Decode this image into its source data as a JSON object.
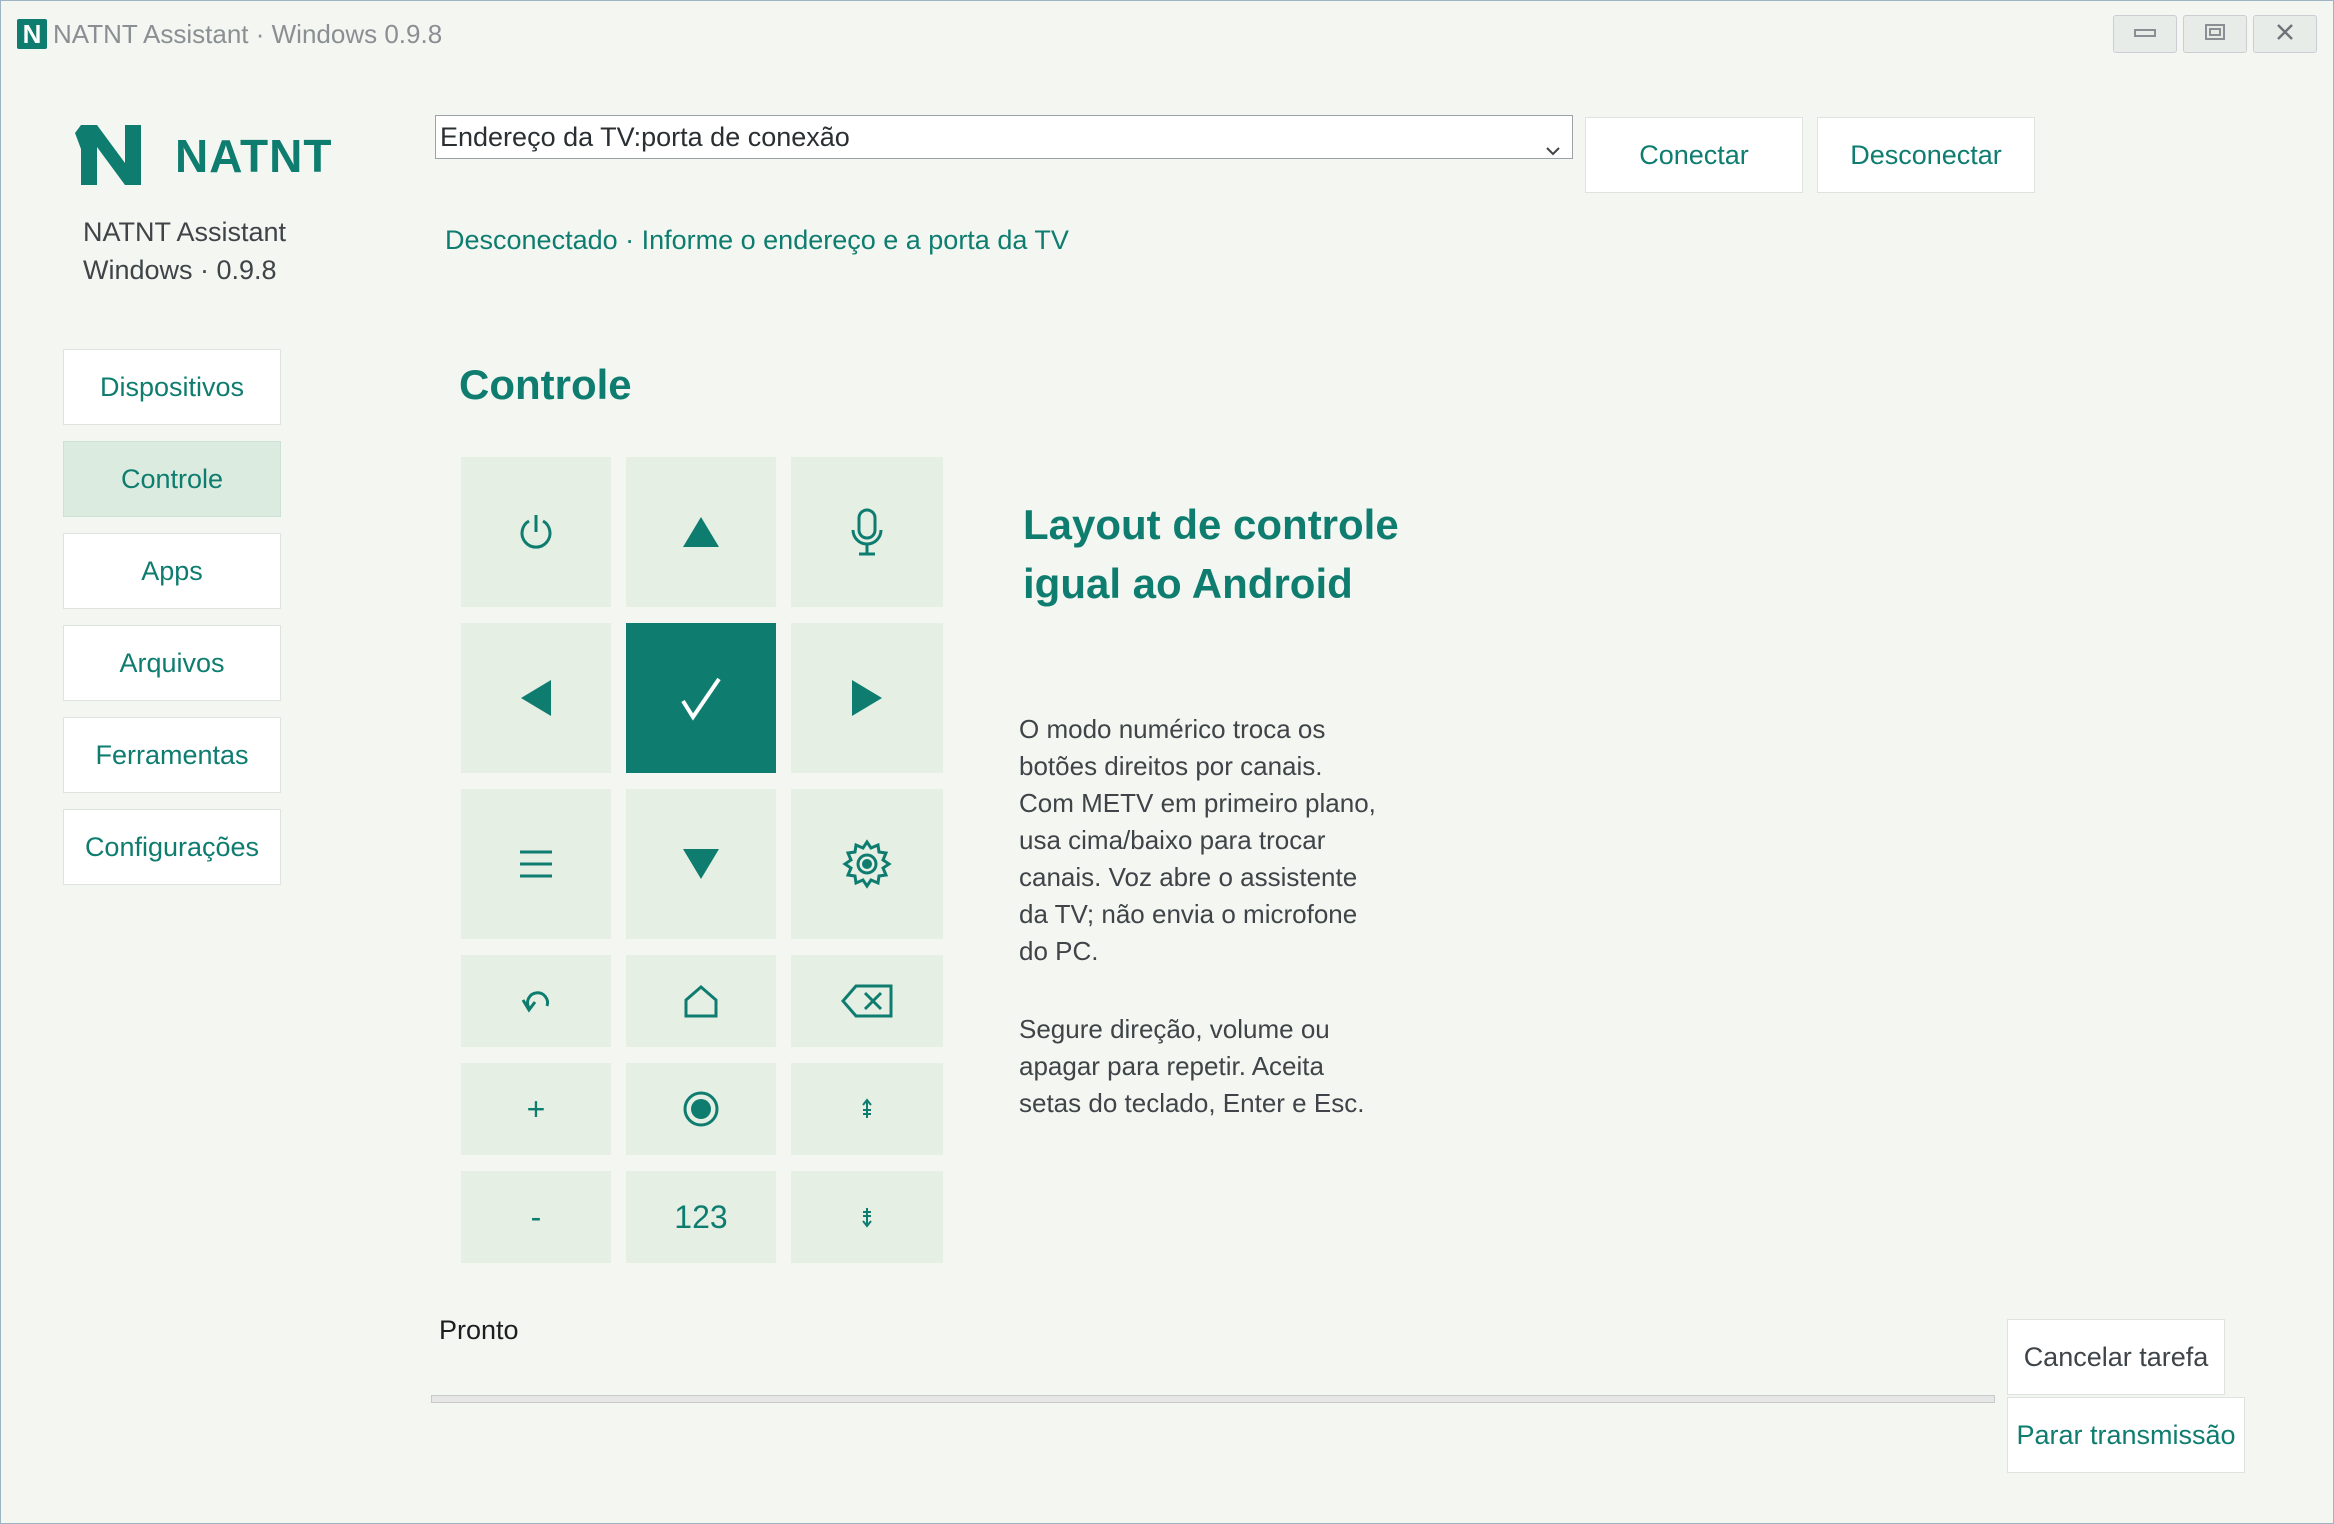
{
  "window": {
    "title": "NATNT Assistant · Windows 0.9.8",
    "app_icon_letter": "N",
    "controls": [
      "minimize-icon",
      "maximize-icon",
      "close-icon"
    ]
  },
  "brand": {
    "logo_text": "NATNT",
    "app_name": "NATNT Assistant",
    "platform_version": "Windows · 0.9.8",
    "accent_color": "#0e7d6f"
  },
  "sidebar": {
    "items": [
      {
        "label": "Dispositivos",
        "active": false
      },
      {
        "label": "Controle",
        "active": true
      },
      {
        "label": "Apps",
        "active": false
      },
      {
        "label": "Arquivos",
        "active": false
      },
      {
        "label": "Ferramentas",
        "active": false
      },
      {
        "label": "Configurações",
        "active": false
      }
    ]
  },
  "connection": {
    "address_value": "Endereço da TV:porta de conexão",
    "connect_label": "Conectar",
    "disconnect_label": "Desconectar",
    "status": "Desconectado · Informe o endereço e a porta da TV"
  },
  "main": {
    "section_title": "Controle",
    "remote_buttons": [
      {
        "name": "power-button",
        "icon": "power-icon"
      },
      {
        "name": "up-button",
        "icon": "triangle-up-icon"
      },
      {
        "name": "voice-button",
        "icon": "microphone-icon"
      },
      {
        "name": "left-button",
        "icon": "triangle-left-icon"
      },
      {
        "name": "ok-button",
        "icon": "checkmark-icon"
      },
      {
        "name": "right-button",
        "icon": "triangle-right-icon"
      },
      {
        "name": "menu-button",
        "icon": "hamburger-icon"
      },
      {
        "name": "down-button",
        "icon": "triangle-down-icon"
      },
      {
        "name": "settings-button",
        "icon": "gear-icon"
      },
      {
        "name": "back-button",
        "icon": "undo-arrow-icon"
      },
      {
        "name": "home-button",
        "icon": "home-icon"
      },
      {
        "name": "delete-button",
        "icon": "backspace-icon"
      },
      {
        "name": "volume-up-button",
        "text": "+"
      },
      {
        "name": "record-button",
        "icon": "record-icon"
      },
      {
        "name": "channel-up-button",
        "icon": "small-arrow-up-icon"
      },
      {
        "name": "volume-down-button",
        "text": "-"
      },
      {
        "name": "numeric-button",
        "text": "123"
      },
      {
        "name": "channel-down-button",
        "icon": "small-arrow-down-icon"
      }
    ],
    "info_title": "Layout de controle igual ao Android",
    "info_paragraph_1": "O modo numérico troca os botões direitos por canais. Com METV em primeiro plano, usa cima/baixo para trocar canais. Voz abre o assistente da TV; não envia o microfone do PC.",
    "info_paragraph_2": "Segure direção, volume ou apagar para repetir. Aceita setas do teclado, Enter e Esc."
  },
  "footer": {
    "status": "Pronto",
    "progress_fraction": 0,
    "cancel_label": "Cancelar tarefa",
    "stop_label": "Parar transmissão"
  }
}
